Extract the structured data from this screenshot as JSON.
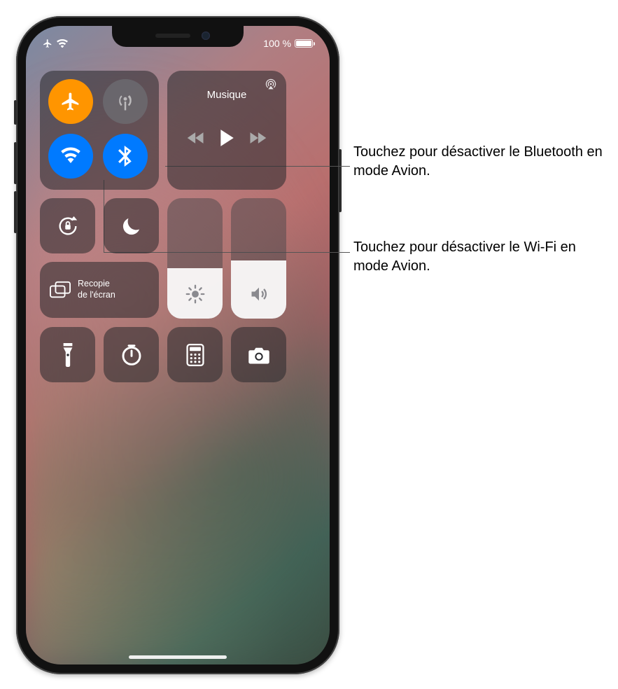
{
  "status": {
    "battery_percent": "100 %"
  },
  "connectivity": {
    "airplane_on": true,
    "cellular_on": false,
    "wifi_on": true,
    "bluetooth_on": true
  },
  "music": {
    "title": "Musique"
  },
  "mirroring": {
    "label_line1": "Recopie",
    "label_line2": "de l'écran"
  },
  "sliders": {
    "brightness_percent": 42,
    "volume_percent": 48
  },
  "callouts": {
    "bluetooth": "Touchez pour désactiver le Bluetooth en mode Avion.",
    "wifi": "Touchez pour désactiver le Wi-Fi en mode Avion."
  },
  "colors": {
    "accent_orange": "#ff9500",
    "accent_blue": "#007aff"
  }
}
